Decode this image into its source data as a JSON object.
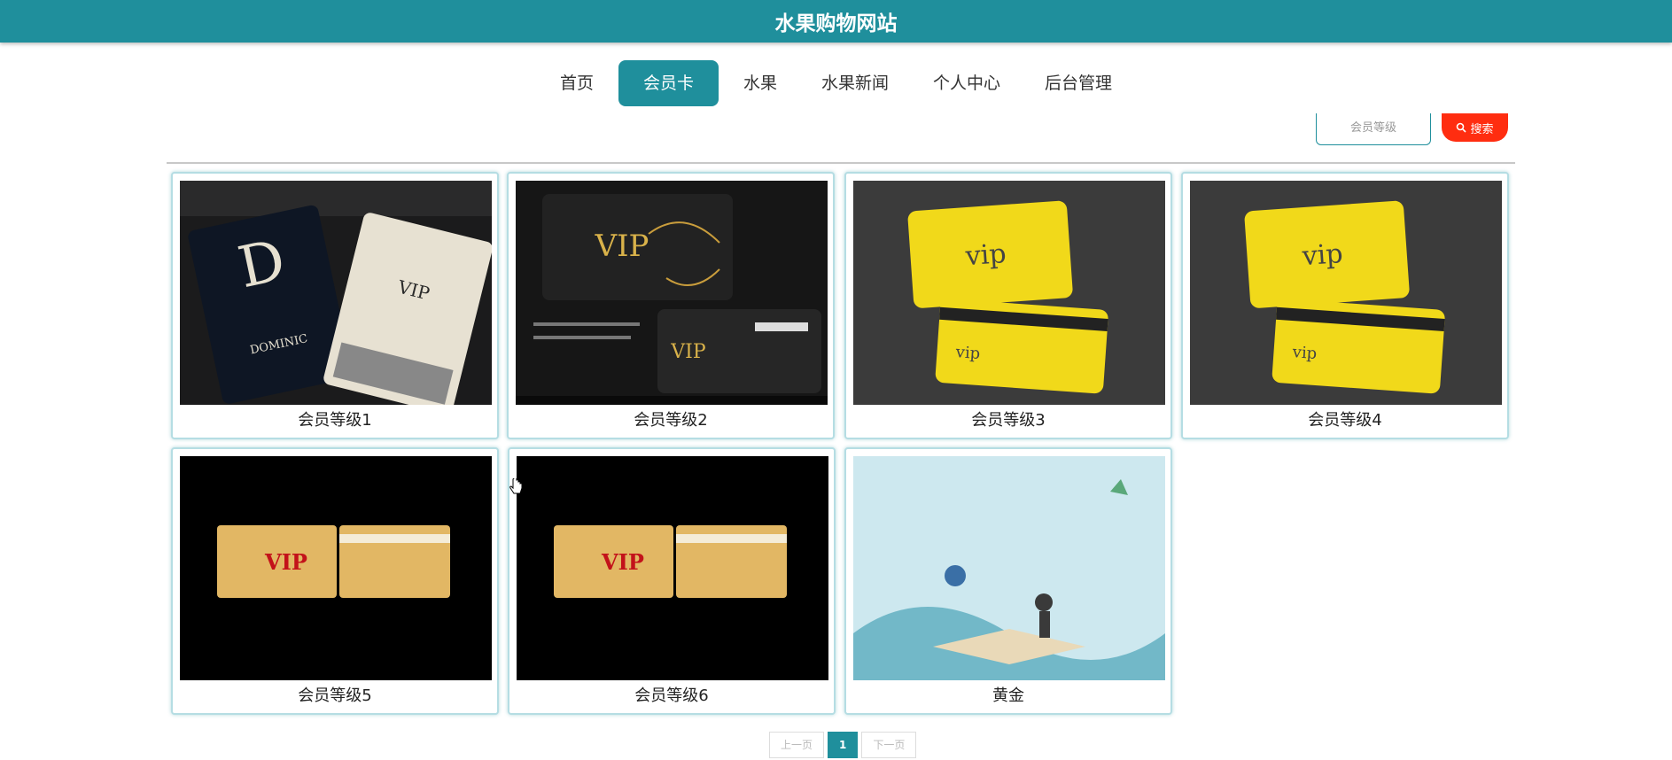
{
  "header": {
    "title": "水果购物网站"
  },
  "nav": {
    "items": [
      "首页",
      "会员卡",
      "水果",
      "水果新闻",
      "个人中心",
      "后台管理"
    ],
    "active": 1
  },
  "search": {
    "placeholder": "会员等级",
    "button": "搜索"
  },
  "cards": [
    {
      "label": "会员等级1"
    },
    {
      "label": "会员等级2"
    },
    {
      "label": "会员等级3"
    },
    {
      "label": "会员等级4"
    },
    {
      "label": "会员等级5"
    },
    {
      "label": "会员等级6"
    },
    {
      "label": "黄金"
    }
  ],
  "pagination": {
    "prev": "上一页",
    "current": "1",
    "next": "下一页"
  },
  "colors": {
    "primary": "#1f8f9c",
    "search_button": "#ff2d10"
  }
}
